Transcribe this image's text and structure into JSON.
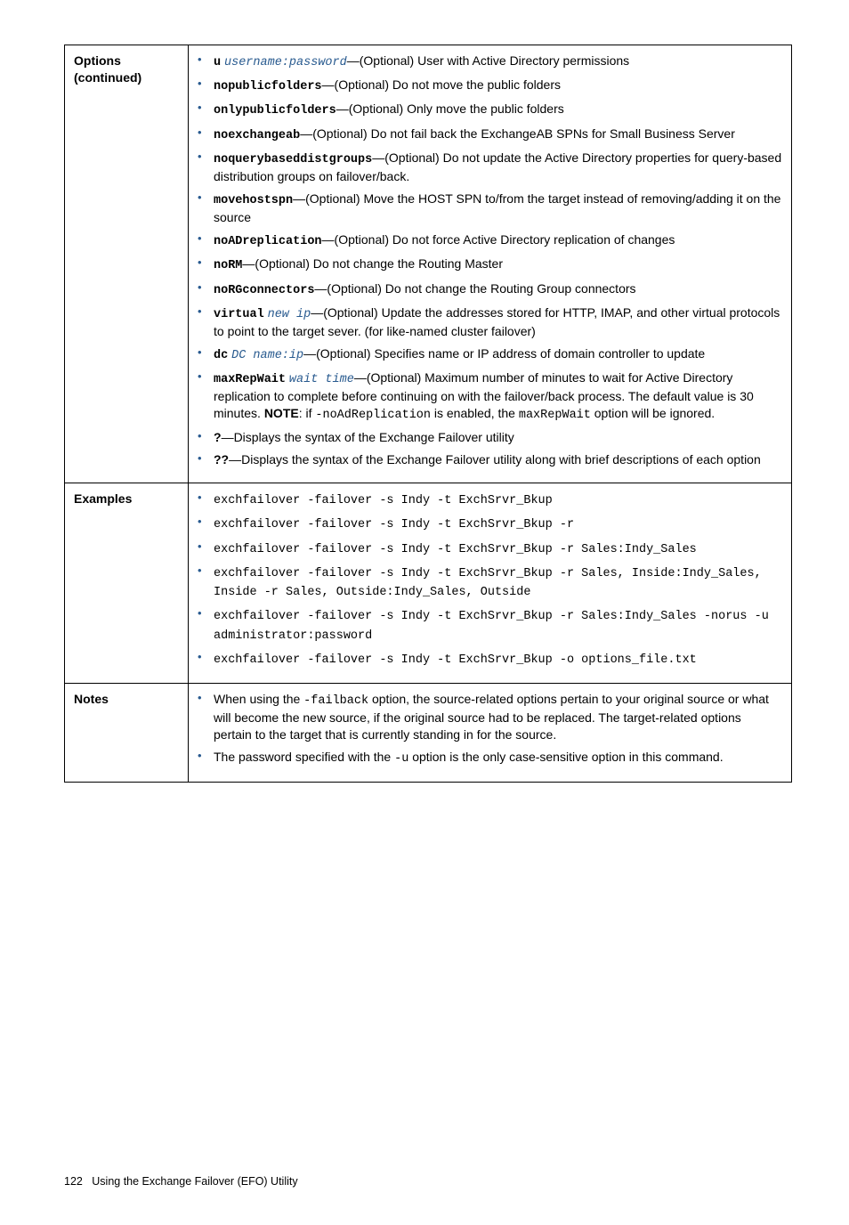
{
  "rows": {
    "options": {
      "label_line1": "Options",
      "label_line2": "(continued)"
    },
    "examples": {
      "label": "Examples"
    },
    "notes": {
      "label": "Notes"
    }
  },
  "opt": {
    "u_cmd": "u",
    "u_var": "username:password",
    "u_desc": "—(Optional) User with Active Directory permissions",
    "nopub_cmd": "nopublicfolders",
    "nopub_desc": "—(Optional) Do not move the public folders",
    "onlypub_cmd": "onlypublicfolders",
    "onlypub_desc": "—(Optional) Only move the public folders",
    "noex_cmd": "noexchangeab",
    "noex_desc": "—(Optional) Do not fail back the ExchangeAB SPNs for Small Business Server",
    "noq_cmd": "noquerybaseddistgroups",
    "noq_desc": "—(Optional) Do not update the Active Directory properties for query-based distribution groups on failover/back.",
    "move_cmd": "movehostspn",
    "move_desc": "—(Optional) Move the HOST SPN to/from the target instead of removing/adding it on the source",
    "noad_cmd": "noADreplication",
    "noad_desc": "—(Optional) Do not force Active Directory replication of changes",
    "norm_cmd": "noRM",
    "norm_desc": "—(Optional) Do not change the Routing Master",
    "norg_cmd": "noRGconnectors",
    "norg_desc": "—(Optional) Do not change the Routing Group connectors",
    "virt_cmd": "virtual",
    "virt_var": "new ip",
    "virt_desc": "—(Optional) Update the addresses stored for HTTP, IMAP, and other virtual protocols to point to the target sever. (for like-named cluster failover)",
    "dc_cmd": "dc",
    "dc_var": "DC name:ip",
    "dc_desc": "—(Optional) Specifies name or IP address of domain controller to update",
    "max_cmd": "maxRepWait",
    "max_var": "wait time",
    "max_pre": "—(Optional) Maximum number of minutes to wait for Active Directory replication to complete before continuing on with the failover/back process. The default value is 30 minutes. ",
    "max_note": "NOTE",
    "max_mid": ": if ",
    "max_code1": "-noAdReplication",
    "max_mid2": " is enabled, the ",
    "max_code2": "maxRepWait",
    "max_post": " option will be ignored.",
    "q1_cmd": "?",
    "q1_desc": "—Displays the syntax of the Exchange Failover utility",
    "q2_cmd": "??",
    "q2_desc": "—Displays the syntax of the Exchange Failover utility along with brief descriptions of each option"
  },
  "ex": {
    "e1": "exchfailover -failover -s Indy -t ExchSrvr_Bkup",
    "e2": "exchfailover -failover -s Indy -t ExchSrvr_Bkup -r",
    "e3": "exchfailover -failover -s Indy -t ExchSrvr_Bkup -r Sales:Indy_Sales",
    "e4": "exchfailover -failover -s Indy -t ExchSrvr_Bkup -r Sales, Inside:Indy_Sales, Inside -r Sales, Outside:Indy_Sales, Outside",
    "e5": "exchfailover -failover -s Indy -t ExchSrvr_Bkup -r Sales:Indy_Sales -norus -u administrator:password",
    "e6": "exchfailover -failover -s Indy -t ExchSrvr_Bkup -o options_file.txt"
  },
  "notes": {
    "n1_pre": "When using the ",
    "n1_code": "-failback",
    "n1_post": " option, the source-related options pertain to your original source or what will become the new source, if the original source had to be replaced. The target-related options pertain to the target that is currently standing in for the source.",
    "n2_pre": "The password specified with the ",
    "n2_code": "-u",
    "n2_post": " option is the only case-sensitive option in this command."
  },
  "footer": {
    "page": "122",
    "title": "Using the Exchange Failover (EFO) Utility"
  }
}
